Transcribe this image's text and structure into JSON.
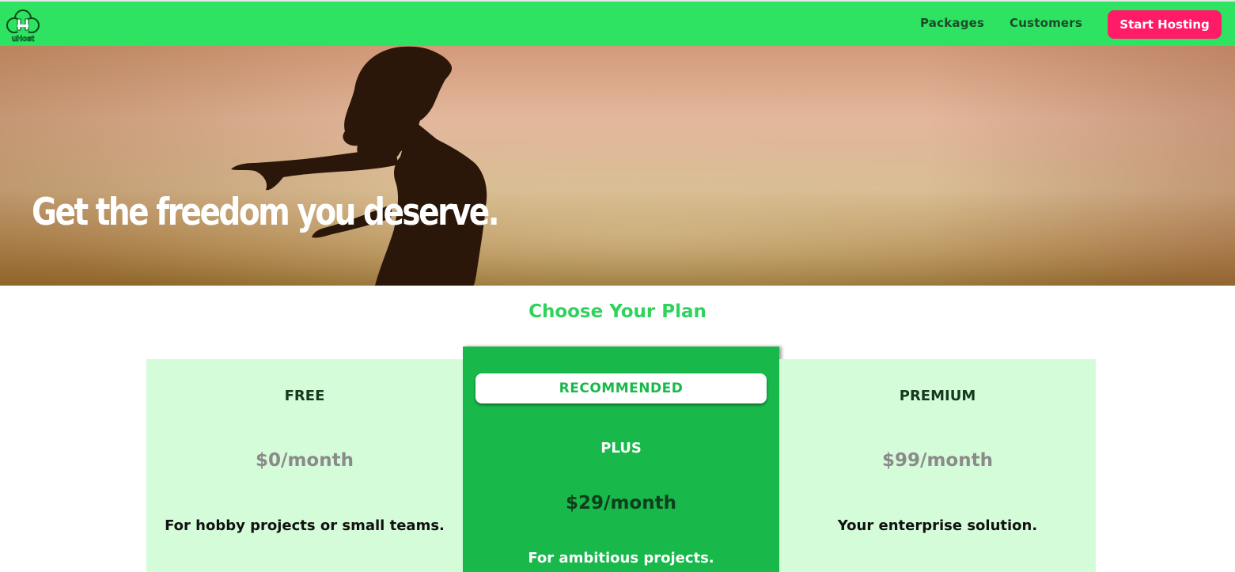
{
  "header": {
    "logo_text": "uHost",
    "nav": {
      "packages": "Packages",
      "customers": "Customers"
    },
    "cta_label": "Start Hosting"
  },
  "hero": {
    "title": "Get the freedom you deserve."
  },
  "plans": {
    "heading": "Choose Your Plan",
    "items": [
      {
        "name": "FREE",
        "price": "$0/month",
        "description": "For hobby projects or small teams."
      },
      {
        "badge": "RECOMMENDED",
        "name": "PLUS",
        "price": "$29/month",
        "description": "For ambitious projects."
      },
      {
        "name": "PREMIUM",
        "price": "$99/month",
        "description": "Your enterprise solution."
      }
    ]
  },
  "colors": {
    "header_bg": "#2ee361",
    "cta_bg": "#ff1b68",
    "accent_green": "#2ed35c",
    "plan_bg": "#d5fcd9",
    "recommended_bg": "#19b84b"
  }
}
